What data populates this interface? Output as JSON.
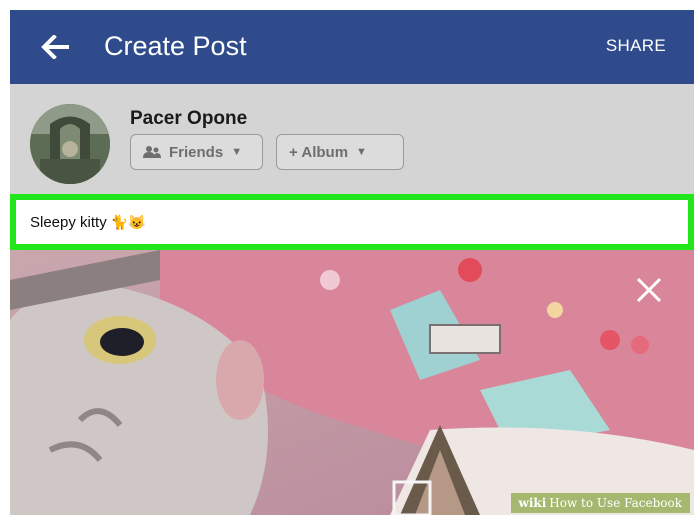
{
  "header": {
    "title": "Create Post",
    "share_label": "SHARE",
    "bg_color": "#2f4b8c"
  },
  "composer": {
    "user_name": "Pacer Opone",
    "audience_label": "Friends",
    "album_label": "+ Album"
  },
  "post": {
    "text": "Sleepy kitty",
    "emoji": "🐈😺",
    "highlight_color": "#22e61c"
  },
  "photo": {
    "close_icon": "close-icon"
  },
  "watermark": {
    "brand": "wiki",
    "text": "How to Use Facebook"
  }
}
